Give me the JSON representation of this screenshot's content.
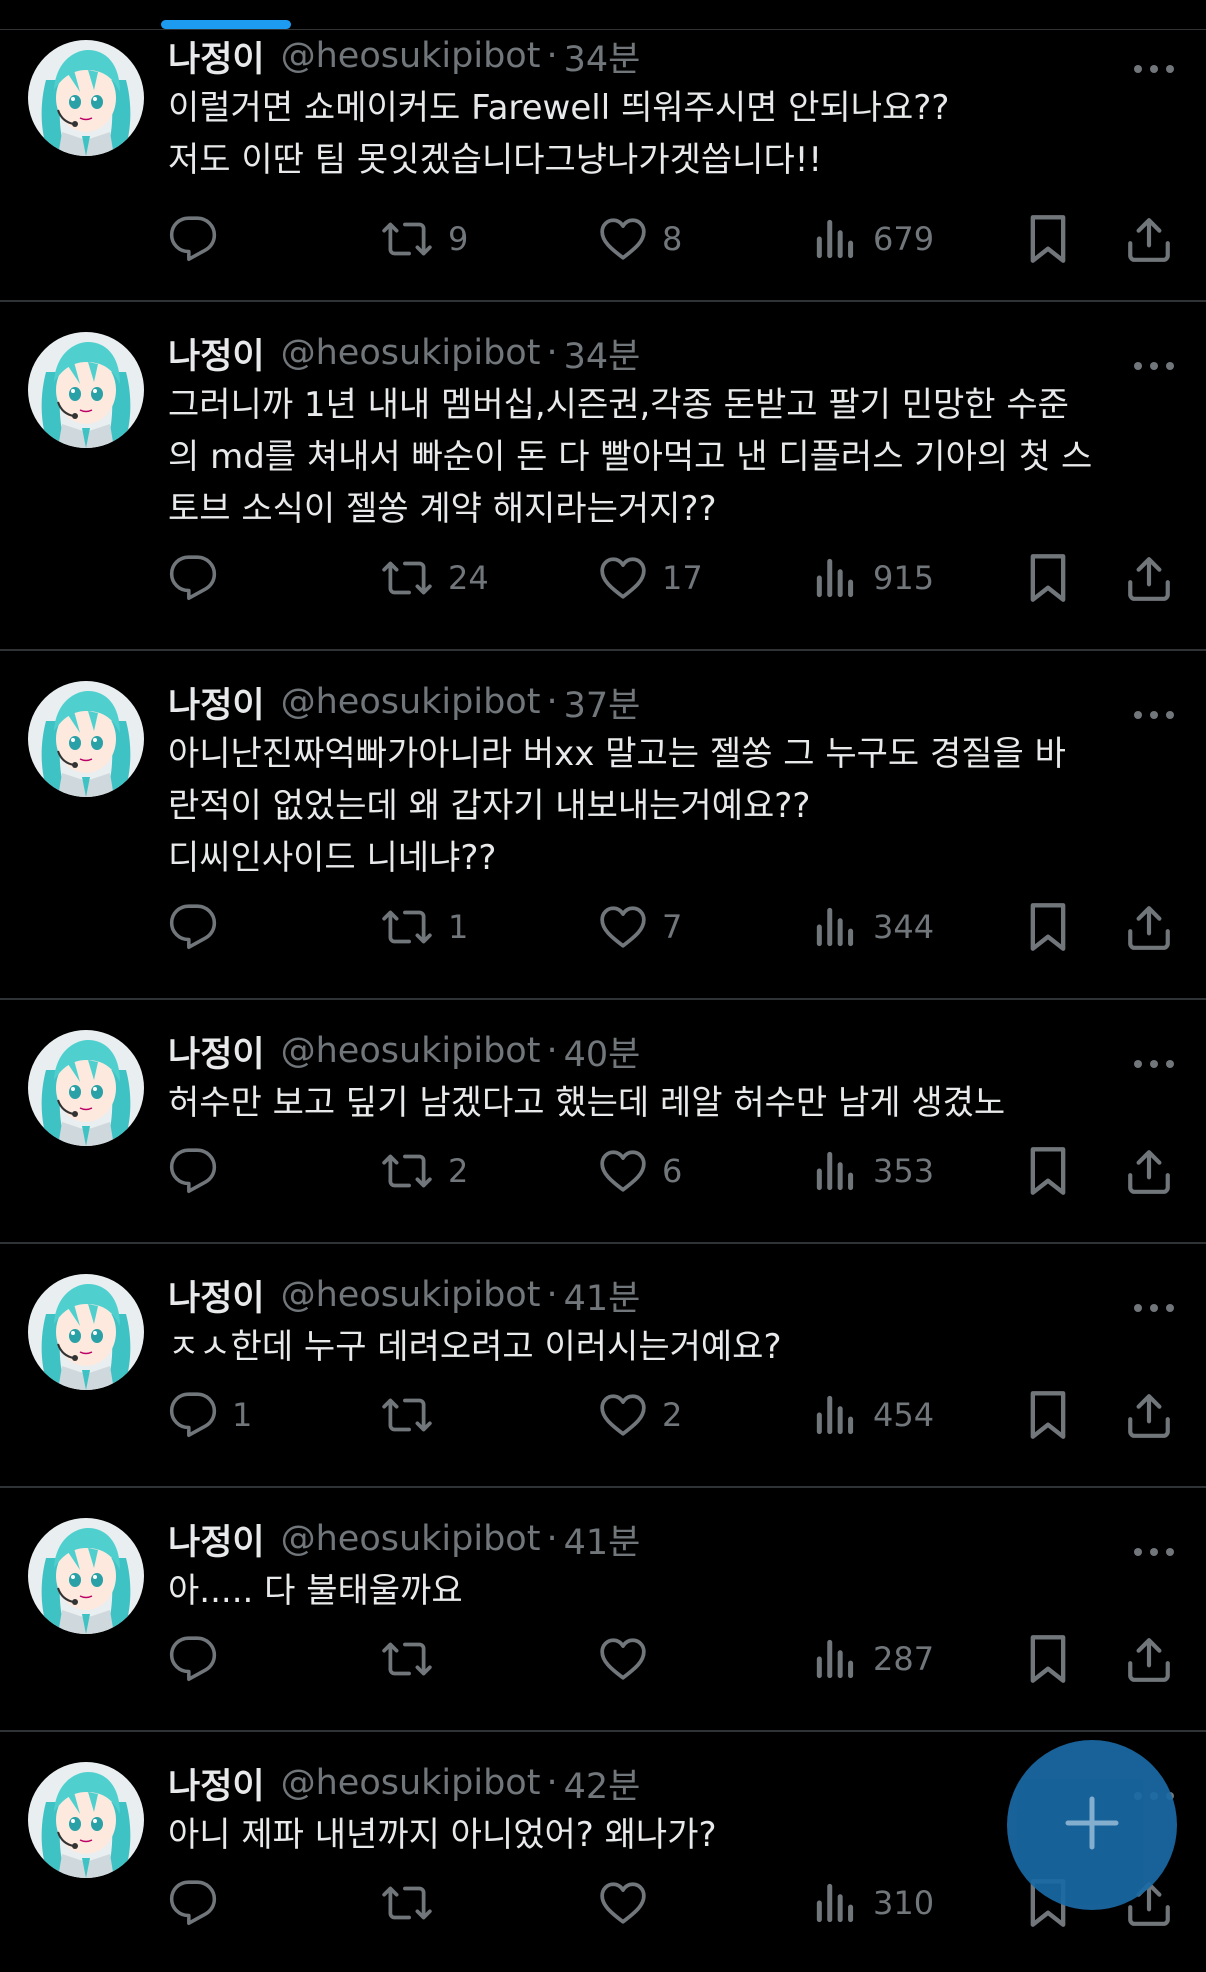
{
  "tweets": [
    {
      "name": "나정이",
      "handle": "@heosukipibot",
      "time": "34분",
      "text": "이럴거면 쇼메이커도 Farewell 띄워주시면 안되나요??\n저도 이딴 팀 못잇겠습니다그냥나가겟씁니다!!",
      "replies": "",
      "retweets": "9",
      "likes": "8",
      "views": "679"
    },
    {
      "name": "나정이",
      "handle": "@heosukipibot",
      "time": "34분",
      "text": "그러니까 1년 내내 멤버십,시즌권,각종 돈받고 팔기 민망한 수준\n의 md를 쳐내서 빠순이 돈 다 빨아먹고 낸 디플러스 기아의 첫 스\n토브 소식이 젤쏭 계약 해지라는거지??",
      "replies": "",
      "retweets": "24",
      "likes": "17",
      "views": "915"
    },
    {
      "name": "나정이",
      "handle": "@heosukipibot",
      "time": "37분",
      "text": "아니난진짜억빠가아니라 버xx 말고는 젤쏭 그 누구도 경질을 바\n란적이 없었는데 왜 갑자기 내보내는거예요??\n디씨인사이드 니네냐??",
      "replies": "",
      "retweets": "1",
      "likes": "7",
      "views": "344"
    },
    {
      "name": "나정이",
      "handle": "@heosukipibot",
      "time": "40분",
      "text": "허수만 보고 딮기 남겠다고 했는데 레알 허수만 남게 생겼노",
      "replies": "",
      "retweets": "2",
      "likes": "6",
      "views": "353"
    },
    {
      "name": "나정이",
      "handle": "@heosukipibot",
      "time": "41분",
      "text": "ㅈㅅ한데 누구 데려오려고 이러시는거예요?",
      "replies": "1",
      "retweets": "",
      "likes": "2",
      "views": "454"
    },
    {
      "name": "나정이",
      "handle": "@heosukipibot",
      "time": "41분",
      "text": "아..... 다 불태울까요",
      "replies": "",
      "retweets": "",
      "likes": "",
      "views": "287"
    },
    {
      "name": "나정이",
      "handle": "@heosukipibot",
      "time": "42분",
      "text": "아니 제파 내년까지 아니었어? 왜나가?",
      "replies": "",
      "retweets": "",
      "likes": "",
      "views": "310"
    }
  ],
  "separator": "·",
  "icons": {
    "reply": "reply-icon",
    "retweet": "retweet-icon",
    "like": "heart-icon",
    "views": "views-icon",
    "bookmark": "bookmark-icon",
    "share": "share-icon",
    "more": "more-icon",
    "compose": "plus-icon"
  },
  "colors": {
    "background": "#000000",
    "text": "#e7e9ea",
    "muted": "#71767b",
    "accent": "#1d9bf0",
    "fab": "#1a6aa6",
    "divider": "#2f3336"
  }
}
